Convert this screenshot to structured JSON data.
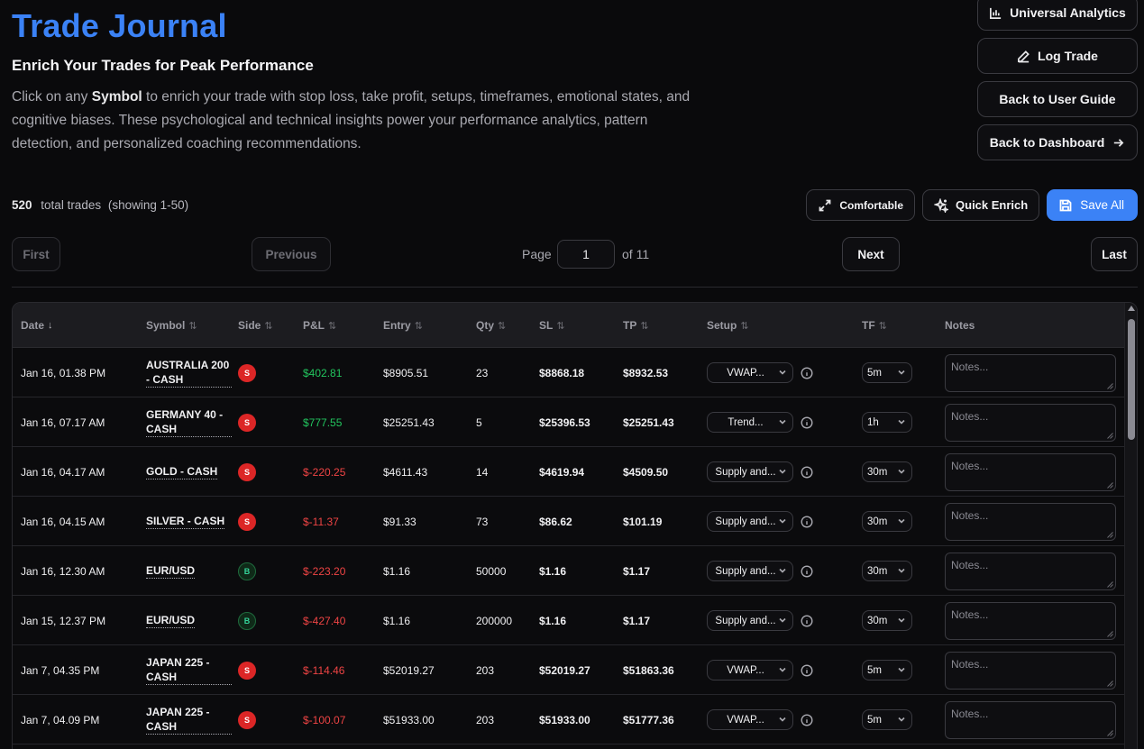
{
  "header": {
    "title": "Trade Journal",
    "subtitle": "Enrich Your Trades for Peak Performance",
    "desc_prefix": "Click on any ",
    "desc_bold": "Symbol",
    "desc_suffix": " to enrich your trade with stop loss, take profit, setups, timeframes, emotional states, and cognitive biases. These psychological and technical insights power your performance analytics, pattern detection, and personalized coaching recommendations."
  },
  "actions": {
    "analytics": "Universal Analytics",
    "log_trade": "Log Trade",
    "user_guide": "Back to User Guide",
    "dashboard": "Back to Dashboard"
  },
  "summary": {
    "total": "520",
    "total_label": "total trades",
    "showing": "(showing 1-50)"
  },
  "toolbar": {
    "comfortable": "Comfortable",
    "quick_enrich": "Quick Enrich",
    "save_all": "Save All"
  },
  "pagination": {
    "first": "First",
    "previous": "Previous",
    "page_label": "Page",
    "page_value": "1",
    "of_label": "of 11",
    "next": "Next",
    "last": "Last"
  },
  "table": {
    "headers": {
      "date": "Date",
      "symbol": "Symbol",
      "side": "Side",
      "pnl": "P&L",
      "entry": "Entry",
      "qty": "Qty",
      "sl": "SL",
      "tp": "TP",
      "setup": "Setup",
      "tf": "TF",
      "notes": "Notes"
    },
    "notes_placeholder": "Notes...",
    "rows": [
      {
        "date": "Jan 16, 01.38 PM",
        "symbol": "AUSTRALIA 200 - CASH",
        "side": "S",
        "pnl": "$402.81",
        "entry": "$8905.51",
        "qty": "23",
        "sl": "$8868.18",
        "tp": "$8932.53",
        "setup": "VWAP...",
        "tf": "5m"
      },
      {
        "date": "Jan 16, 07.17 AM",
        "symbol": "GERMANY 40 - CASH",
        "side": "S",
        "pnl": "$777.55",
        "entry": "$25251.43",
        "qty": "5",
        "sl": "$25396.53",
        "tp": "$25251.43",
        "setup": "Trend...",
        "tf": "1h"
      },
      {
        "date": "Jan 16, 04.17 AM",
        "symbol": "GOLD - CASH",
        "side": "S",
        "pnl": "$-220.25",
        "entry": "$4611.43",
        "qty": "14",
        "sl": "$4619.94",
        "tp": "$4509.50",
        "setup": "Supply and...",
        "tf": "30m"
      },
      {
        "date": "Jan 16, 04.15 AM",
        "symbol": "SILVER - CASH",
        "side": "S",
        "pnl": "$-11.37",
        "entry": "$91.33",
        "qty": "73",
        "sl": "$86.62",
        "tp": "$101.19",
        "setup": "Supply and...",
        "tf": "30m"
      },
      {
        "date": "Jan 16, 12.30 AM",
        "symbol": "EUR/USD",
        "side": "B",
        "pnl": "$-223.20",
        "entry": "$1.16",
        "qty": "50000",
        "sl": "$1.16",
        "tp": "$1.17",
        "setup": "Supply and...",
        "tf": "30m"
      },
      {
        "date": "Jan 15, 12.37 PM",
        "symbol": "EUR/USD",
        "side": "B",
        "pnl": "$-427.40",
        "entry": "$1.16",
        "qty": "200000",
        "sl": "$1.16",
        "tp": "$1.17",
        "setup": "Supply and...",
        "tf": "30m"
      },
      {
        "date": "Jan 7, 04.35 PM",
        "symbol": "JAPAN 225 - CASH",
        "side": "S",
        "pnl": "$-114.46",
        "entry": "$52019.27",
        "qty": "203",
        "sl": "$52019.27",
        "tp": "$51863.36",
        "setup": "VWAP...",
        "tf": "5m"
      },
      {
        "date": "Jan 7, 04.09 PM",
        "symbol": "JAPAN 225 - CASH",
        "side": "S",
        "pnl": "$-100.07",
        "entry": "$51933.00",
        "qty": "203",
        "sl": "$51933.00",
        "tp": "$51777.36",
        "setup": "VWAP...",
        "tf": "5m"
      }
    ]
  },
  "colors": {
    "accent": "#3b82f6",
    "profit": "#22c55e",
    "loss": "#ef4444",
    "sell_badge": "#dc2626",
    "buy_badge": "#34d399"
  },
  "icons": {
    "analytics": "bar-chart-icon",
    "log_trade": "pencil-icon",
    "dashboard": "arrow-right-icon",
    "comfortable": "expand-icon",
    "quick_enrich": "sparkles-icon",
    "save_all": "save-icon"
  }
}
